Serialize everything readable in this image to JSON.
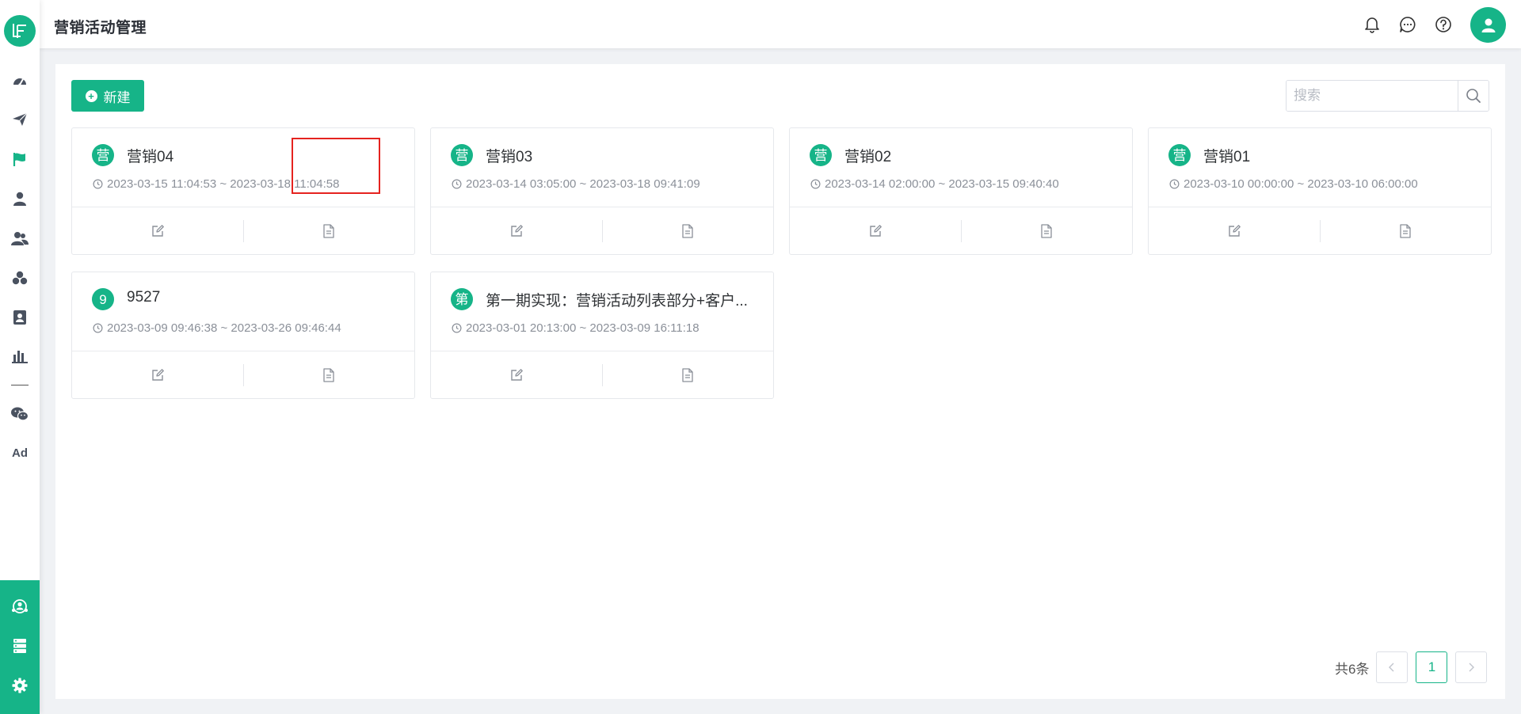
{
  "header": {
    "title": "营销活动管理"
  },
  "toolbar": {
    "new_label": "新建",
    "search_placeholder": "搜索"
  },
  "campaigns": [
    {
      "badge": "营",
      "name": "营销04",
      "time": "2023-03-15 11:04:53 ~ 2023-03-18 11:04:58"
    },
    {
      "badge": "营",
      "name": "营销03",
      "time": "2023-03-14 03:05:00 ~ 2023-03-18 09:41:09"
    },
    {
      "badge": "营",
      "name": "营销02",
      "time": "2023-03-14 02:00:00 ~ 2023-03-15 09:40:40"
    },
    {
      "badge": "营",
      "name": "营销01",
      "time": "2023-03-10 00:00:00 ~ 2023-03-10 06:00:00"
    },
    {
      "badge": "9",
      "name": "9527",
      "time": "2023-03-09 09:46:38 ~ 2023-03-26 09:46:44"
    },
    {
      "badge": "第",
      "name": "第一期实现：营销活动列表部分+客户...",
      "time": "2023-03-01 20:13:00 ~ 2023-03-09 16:11:18"
    }
  ],
  "pagination": {
    "total_label": "共6条",
    "current_page": "1"
  },
  "sidebar": {
    "ad_label": "Ad"
  },
  "colors": {
    "accent": "#16b488",
    "highlight": "#e5231f"
  }
}
